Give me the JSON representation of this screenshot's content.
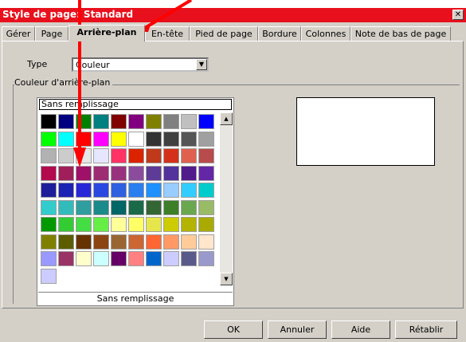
{
  "window": {
    "title": "Style de page: Standard",
    "close_glyph": "✕"
  },
  "tabs": [
    {
      "label": "Gérer"
    },
    {
      "label": "Page"
    },
    {
      "label": "Arrière-plan",
      "active": true
    },
    {
      "label": "En-tête"
    },
    {
      "label": "Pied de page"
    },
    {
      "label": "Bordure"
    },
    {
      "label": "Colonnes"
    },
    {
      "label": "Note de bas de page"
    }
  ],
  "type_field": {
    "label": "Type",
    "value": "Couleur"
  },
  "background": {
    "group_label": "Couleur d'arrière-plan",
    "selected_name": "Sans remplissage",
    "caption": "Sans remplissage",
    "colors": [
      [
        "#000000",
        "#000080",
        "#008000",
        "#008080",
        "#800000",
        "#800080",
        "#808000",
        "#808080",
        "#c0c0c0",
        "#0000ff"
      ],
      [
        "#00ff00",
        "#00ffff",
        "#ff0000",
        "#ff00ff",
        "#ffff00",
        "#ffffff",
        "#333333",
        "#404040",
        "#555555",
        "#a0a0a0"
      ],
      [
        "#b2b2b2",
        "#cccccc",
        "#e6e6e6",
        "#e6e6ff",
        "#ff3366",
        "#dc2300",
        "#c0391b",
        "#d4311a",
        "#e0604f",
        "#b84c4c"
      ],
      [
        "#b30a4e",
        "#a01f5a",
        "#9f1168",
        "#9e2c73",
        "#99327e",
        "#8b4c9e",
        "#5e3b97",
        "#52329b",
        "#511b8c",
        "#6327a6"
      ],
      [
        "#1e1e9a",
        "#1c23b4",
        "#2828d8",
        "#2a48e0",
        "#2e60e0",
        "#2a7ef0",
        "#1e90ff",
        "#99ccff",
        "#33ccff",
        "#00cccc"
      ],
      [
        "#33cccc",
        "#33bbbb",
        "#2e9e9e",
        "#1a8a8a",
        "#006666",
        "#1a6a4a",
        "#336633",
        "#3c7f28",
        "#6aa84f",
        "#99bb66"
      ],
      [
        "#009900",
        "#33cc33",
        "#44dd44",
        "#66ee44",
        "#ffff99",
        "#ffff66",
        "#e6e64c",
        "#cccc00",
        "#b3b300",
        "#aaaa00"
      ],
      [
        "#808000",
        "#5c5c00",
        "#663300",
        "#8b4513",
        "#996633",
        "#cc6633",
        "#ff6633",
        "#ff9966",
        "#ffcc99",
        "#ffe6cc"
      ],
      [
        "#9999ff",
        "#993366",
        "#ffffcc",
        "#ccffff",
        "#660066",
        "#ff8080",
        "#0066cc",
        "#ccccff",
        "#5a5a8a",
        "#9999cc"
      ],
      [
        "#ccccff"
      ]
    ]
  },
  "buttons": {
    "ok": "OK",
    "cancel": "Annuler",
    "help": "Aide",
    "reset": "Rétablir"
  },
  "annotation_color": "#ff0000"
}
